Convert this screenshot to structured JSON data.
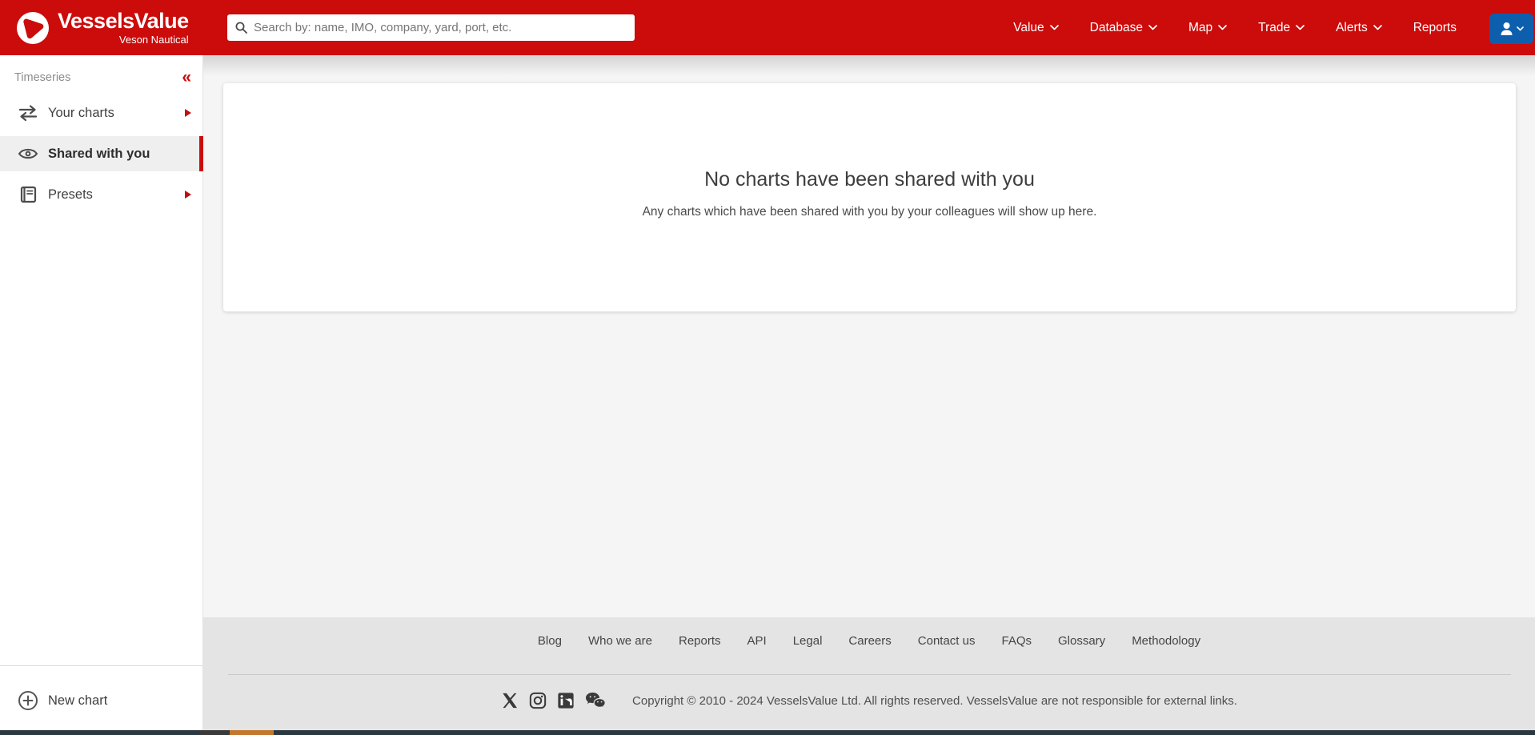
{
  "header": {
    "brand": {
      "name": "VesselsValue",
      "tagline": "Veson Nautical"
    },
    "search": {
      "placeholder": "Search by: name, IMO, company, yard, port, etc."
    },
    "nav": [
      {
        "label": "Value"
      },
      {
        "label": "Database"
      },
      {
        "label": "Map"
      },
      {
        "label": "Trade"
      },
      {
        "label": "Alerts"
      },
      {
        "label": "Reports"
      }
    ]
  },
  "sidebar": {
    "section_title": "Timeseries",
    "collapse_glyph": "«",
    "items": [
      {
        "label": "Your charts"
      },
      {
        "label": "Shared with you"
      },
      {
        "label": "Presets"
      }
    ],
    "new_chart_label": "New chart"
  },
  "main": {
    "empty_state": {
      "title": "No charts have been shared with you",
      "description": "Any charts which have been shared with you by your colleagues will show up here."
    }
  },
  "footer": {
    "links": [
      "Blog",
      "Who we are",
      "Reports",
      "API",
      "Legal",
      "Careers",
      "Contact us",
      "FAQs",
      "Glossary",
      "Methodology"
    ],
    "copyright": "Copyright © 2010 - 2024 VesselsValue Ltd. All rights reserved. VesselsValue are not responsible for external links."
  },
  "colors": {
    "brand_red": "#cc0b0b",
    "user_button_blue": "#0d5fae",
    "footer_bg": "#e4e4e4",
    "taskbar_orange": "#c2762e"
  }
}
